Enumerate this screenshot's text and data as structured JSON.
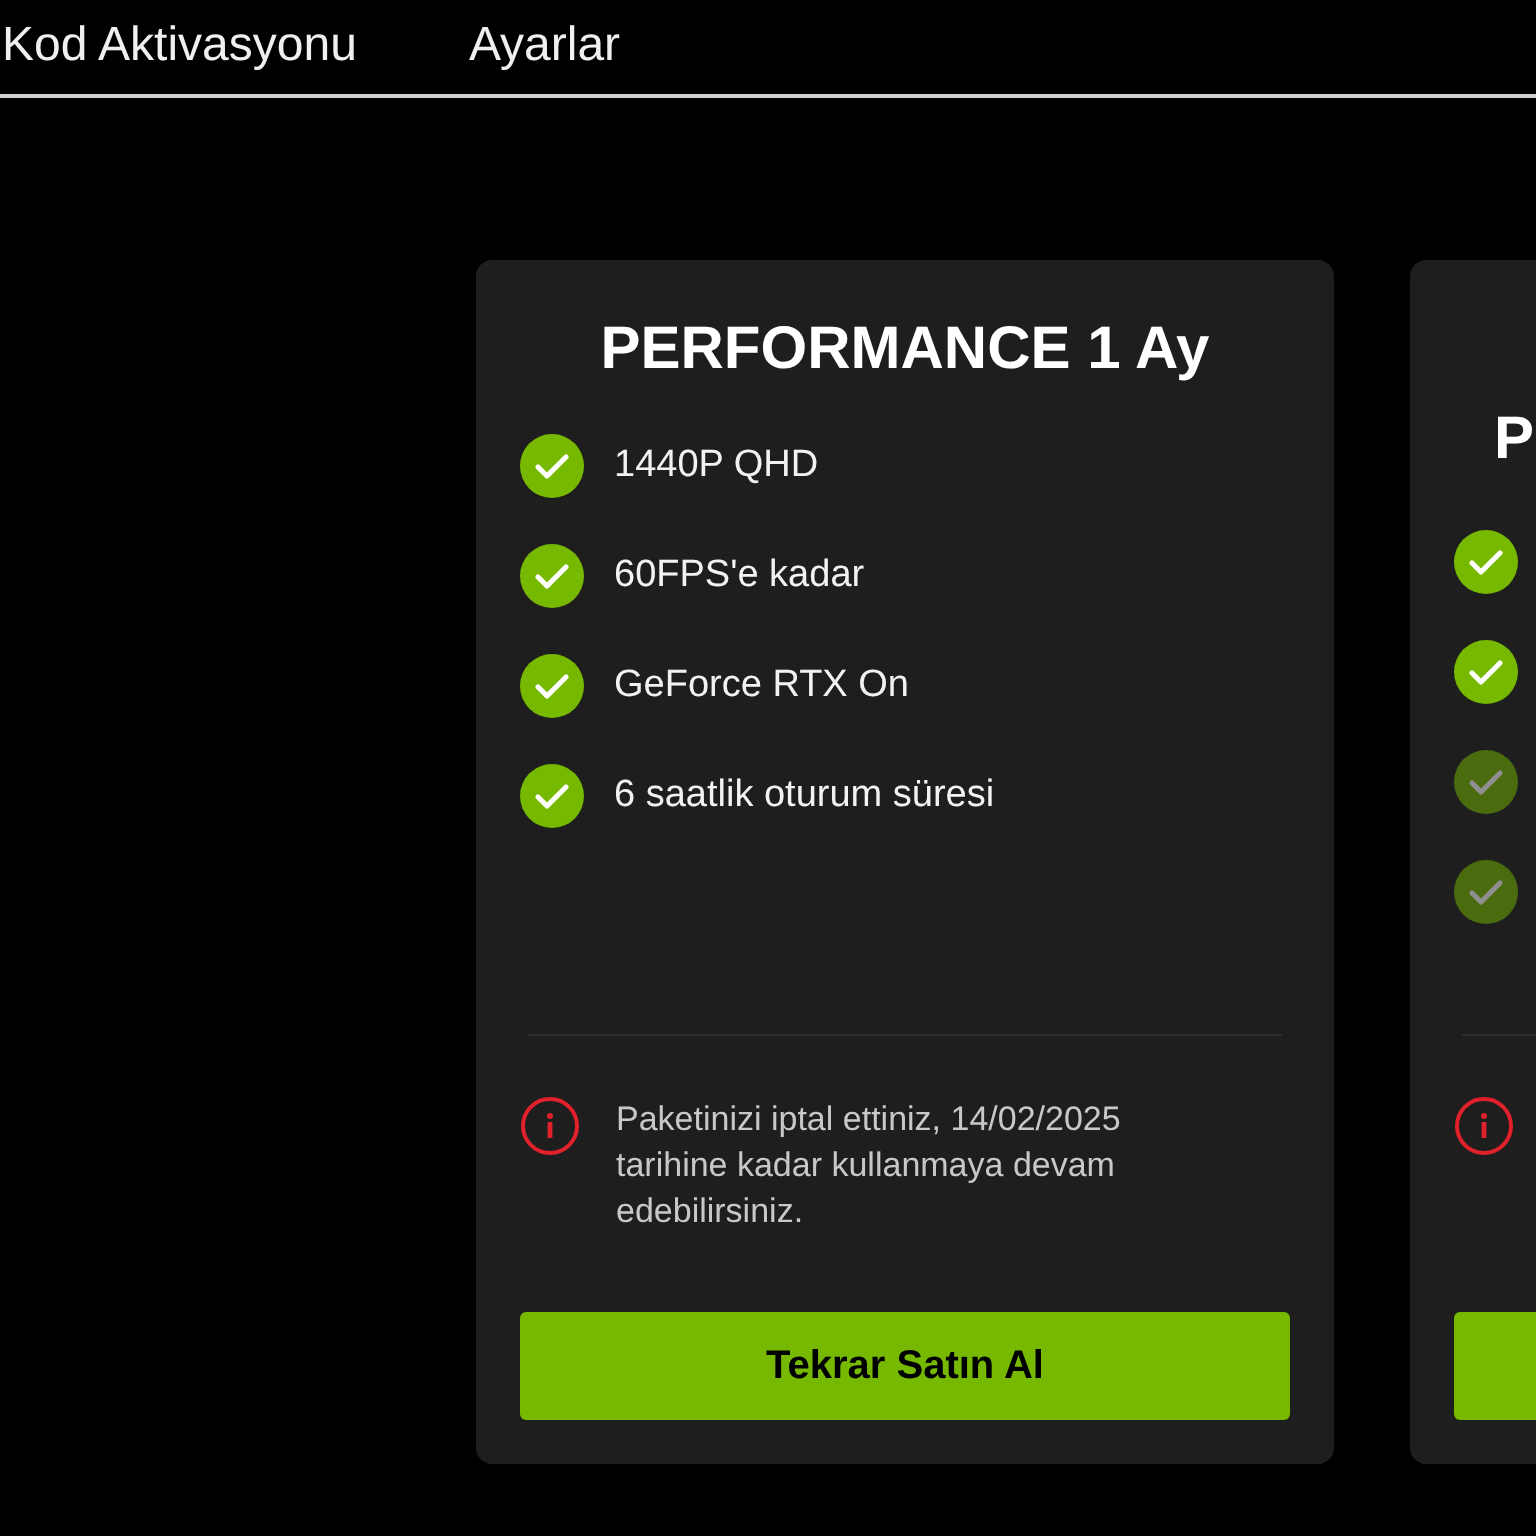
{
  "nav": [
    {
      "label": "Kod Aktivasyonu"
    },
    {
      "label": "Ayarlar"
    }
  ],
  "cards": [
    {
      "kind": "full",
      "title": "PERFORMANCE 1 Ay",
      "features": [
        {
          "label": "1440P QHD",
          "faded": false
        },
        {
          "label": "60FPS'e kadar",
          "faded": false
        },
        {
          "label": "GeForce RTX On",
          "faded": false
        },
        {
          "label": "6 saatlik oturum süresi",
          "faded": false
        }
      ],
      "notice": "Paketinizi iptal ettiniz, 14/02/2025 tarihine kadar kullanmaya devam edebilirsiniz.",
      "button": "Tekrar Satın Al"
    },
    {
      "kind": "cut",
      "title": "P",
      "features": [
        {
          "faded": false
        },
        {
          "faded": false
        },
        {
          "faded": true
        },
        {
          "faded": true
        }
      ]
    }
  ]
}
